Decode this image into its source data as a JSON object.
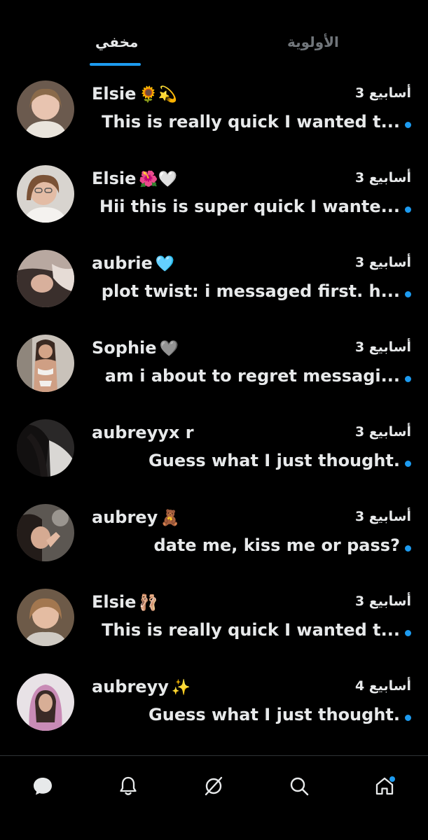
{
  "tabs": {
    "hidden_label": "مخفي",
    "priority_label": "الأولوية",
    "active": "hidden"
  },
  "conversations": [
    {
      "name": "Elsie",
      "emoji": "🌻💫",
      "time": "3 أسابيع",
      "message": "This is really quick I wanted t...",
      "unread": true
    },
    {
      "name": "Elsie",
      "emoji": "🌺🤍",
      "time": "3 أسابيع",
      "message": "Hii this is super quick I wante...",
      "unread": true
    },
    {
      "name": "aubrie",
      "emoji": "🩵",
      "time": "3 أسابيع",
      "message": "plot twist: i messaged first. h...",
      "unread": true
    },
    {
      "name": "Sophie",
      "emoji": "🩶",
      "time": "3 أسابيع",
      "message": "am i about to regret messagi...",
      "unread": true
    },
    {
      "name": "aubreyyx r",
      "emoji": "",
      "time": "3 أسابيع",
      "message": "Guess what I just thought.",
      "unread": true
    },
    {
      "name": "aubrey",
      "emoji": "🧸",
      "time": "3 أسابيع",
      "message": "date me, kiss me or pass?",
      "unread": true
    },
    {
      "name": "Elsie",
      "emoji": "🩰",
      "time": "3 أسابيع",
      "message": "This is really quick I wanted t...",
      "unread": true
    },
    {
      "name": "aubreyy",
      "emoji": "✨",
      "time": "4 أسابيع",
      "message": "Guess what I just thought.",
      "unread": true
    }
  ],
  "nav": {
    "items": [
      "messages-icon",
      "notifications-icon",
      "grok-icon",
      "search-icon",
      "home-icon"
    ],
    "home_has_badge": true
  },
  "colors": {
    "background": "#000000",
    "accent": "#1d9bf0",
    "text": "#e7e9ea",
    "muted": "#71767b"
  }
}
